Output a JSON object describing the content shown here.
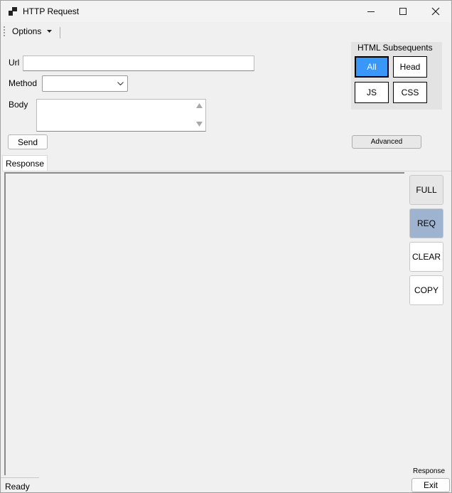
{
  "window": {
    "title": "HTTP Request"
  },
  "titlebar": {
    "minimize_icon": "minimize-icon",
    "maximize_icon": "maximize-icon",
    "close_icon": "close-icon"
  },
  "menu": {
    "options_label": "Options"
  },
  "form": {
    "url_label": "Url",
    "url_value": "",
    "method_label": "Method",
    "method_value": "",
    "body_label": "Body",
    "body_value": "",
    "send_label": "Send",
    "advanced_label": "Advanced"
  },
  "subsequents": {
    "title": "HTML Subsequents",
    "buttons": [
      {
        "label": "All",
        "selected": true
      },
      {
        "label": "Head",
        "selected": false
      },
      {
        "label": "JS",
        "selected": false
      },
      {
        "label": "CSS",
        "selected": false
      }
    ],
    "selected_color": "#3a96f8"
  },
  "response": {
    "tab_label": "Response",
    "side_buttons": [
      {
        "label": "FULL",
        "color": "#e6e6e6"
      },
      {
        "label": "REQ",
        "color": "#9db3cf"
      },
      {
        "label": "CLEAR",
        "color": "#ffffff"
      },
      {
        "label": "COPY",
        "color": "#ffffff"
      }
    ],
    "corner_label": "Response"
  },
  "status": {
    "text": "Ready",
    "exit_label": "Exit"
  }
}
